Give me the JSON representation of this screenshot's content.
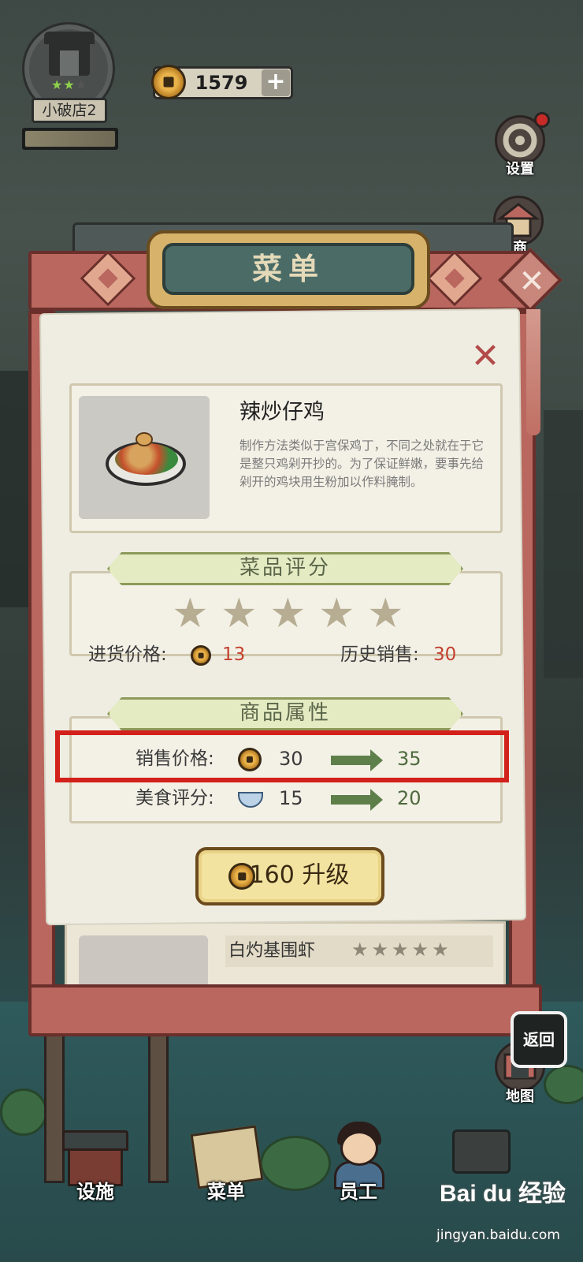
{
  "hud": {
    "shop_name": "小破店2",
    "shop_stars_filled": 2,
    "shop_stars_total": 3,
    "coins": "1579",
    "coin_plus": "+"
  },
  "side_buttons": {
    "settings": "设置",
    "shop_partial": "商",
    "map": "地图"
  },
  "board": {
    "title": "菜单"
  },
  "dish": {
    "name": "辣炒仔鸡",
    "description": "制作方法类似于宫保鸡丁，不同之处就在于它是整只鸡剁开抄的。为了保证鲜嫩，要事先给剁开的鸡块用生粉加以作料腌制。"
  },
  "rating_section": {
    "title": "菜品评分",
    "stars": 5,
    "purchase_price_label": "进货价格:",
    "purchase_price": "13",
    "history_sales_label": "历史销售:",
    "history_sales": "30"
  },
  "attributes_section": {
    "title": "商品属性",
    "sale_price_label": "销售价格:",
    "sale_price_current": "30",
    "sale_price_next": "35",
    "food_rating_label": "美食评分:",
    "food_rating_current": "15",
    "food_rating_next": "20"
  },
  "upgrade": {
    "label": "160 升级"
  },
  "list_behind": {
    "item_name": "白灼基围虾",
    "item_stars": 5
  },
  "bottom_nav": {
    "facilities": "设施",
    "menu": "菜单",
    "staff": "员工"
  },
  "back_button": "返回",
  "watermark": {
    "brand": "Bai du 经验",
    "url": "jingyan.baidu.com"
  },
  "colors": {
    "highlight": "#d2211a",
    "red_number": "#c4412f",
    "green_new_value": "#4d6a3d",
    "banner_bg": "#e4ebc3"
  }
}
